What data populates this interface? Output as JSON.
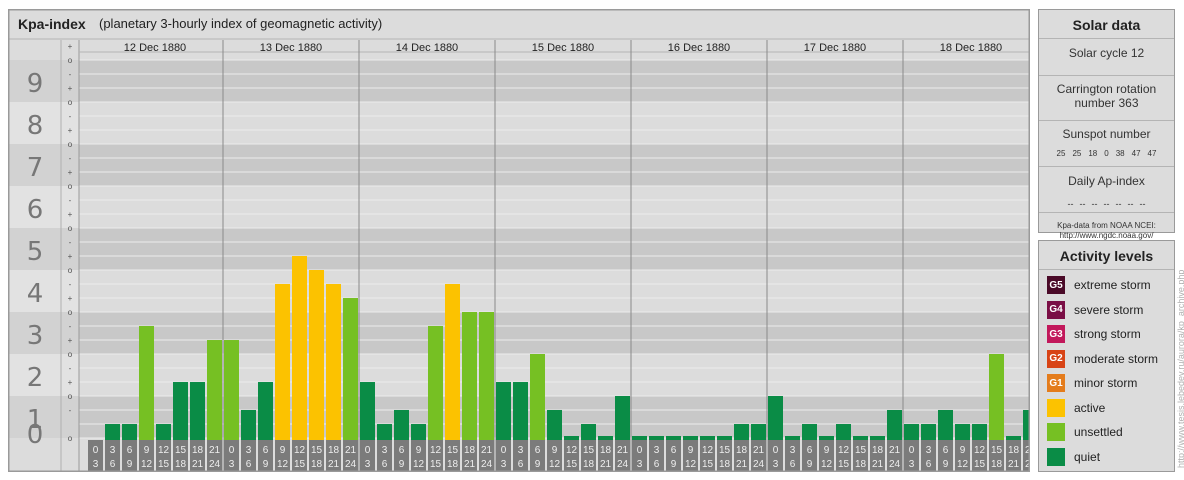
{
  "chart": {
    "title": "Kpa-index",
    "subtitle": "(planetary 3-hourly index of geomagnetic activity)"
  },
  "chart_data": {
    "type": "bar",
    "ylim": [
      0,
      9
    ],
    "y_ticks": [
      "0",
      "1",
      "2",
      "3",
      "4",
      "5",
      "6",
      "7",
      "8",
      "9"
    ],
    "sub_ticks": [
      "-",
      "o",
      "+"
    ],
    "days": [
      "12 Dec 1880",
      "13 Dec 1880",
      "14 Dec 1880",
      "15 Dec 1880",
      "16 Dec 1880",
      "17 Dec 1880",
      "18 Dec 1880"
    ],
    "interval_starts": [
      "0",
      "3",
      "6",
      "9",
      "12",
      "15",
      "18",
      "21"
    ],
    "interval_ends": [
      "3",
      "6",
      "9",
      "12",
      "15",
      "18",
      "21",
      "24"
    ],
    "values": [
      [
        0.333,
        0.333,
        2.667,
        0.333,
        1.333,
        1.333,
        2.333
      ],
      [
        2.333,
        0.667,
        1.333,
        3.667,
        4.333,
        4.0,
        3.667,
        3.333
      ],
      [
        1.333,
        0.333,
        0.667,
        0.333,
        2.667,
        3.667,
        3.0,
        3.0
      ],
      [
        1.333,
        1.333,
        2.0,
        0.667,
        0.0,
        0.333,
        0.0,
        1.0
      ],
      [
        0.0,
        0.0,
        0.0,
        0.0,
        0.0,
        0.0,
        0.333,
        0.333
      ],
      [
        1.0,
        0.0,
        0.333,
        0.0,
        0.333,
        0.0,
        0.0,
        0.667
      ],
      [
        0.333,
        0.333,
        0.667,
        0.333,
        0.333,
        2.0,
        0.0,
        0.667
      ]
    ],
    "colors": {
      "quiet": "#0a8c46",
      "unsettled": "#76c023",
      "active": "#fcc200",
      "axis_number": "#777777",
      "interval_cell": "#7b7b7b",
      "band_dark": "#c8c8c8",
      "band_light": "#dcdcdc"
    },
    "grid": true
  },
  "solar": {
    "title": "Solar data",
    "cycle": "Solar cycle 12",
    "carrington_line1": "Carrington rotation",
    "carrington_line2": "number 363",
    "sunspot_title": "Sunspot number",
    "sunspots": [
      "25",
      "25",
      "18",
      "0",
      "38",
      "47",
      "47"
    ],
    "ap_title": "Daily Ap-index",
    "ap_values": [
      "--",
      "--",
      "--",
      "--",
      "--",
      "--",
      "--"
    ],
    "source_line1": "Kpa-data from NOAA NCEI:",
    "source_line2": "http://www.ngdc.noaa.gov/"
  },
  "activity": {
    "title": "Activity levels",
    "items": [
      {
        "badge": "G5",
        "label": "extreme storm",
        "color": "#4a0a28"
      },
      {
        "badge": "G4",
        "label": "severe storm",
        "color": "#7a0e45"
      },
      {
        "badge": "G3",
        "label": "strong storm",
        "color": "#c2185b"
      },
      {
        "badge": "G2",
        "label": "moderate storm",
        "color": "#d84315"
      },
      {
        "badge": "G1",
        "label": "minor storm",
        "color": "#e47c1c"
      },
      {
        "badge": "",
        "label": "active",
        "color": "#fcc200"
      },
      {
        "badge": "",
        "label": "unsettled",
        "color": "#76c023"
      },
      {
        "badge": "",
        "label": "quiet",
        "color": "#0a8c46"
      }
    ]
  },
  "watermark": "http://www.tesis.lebedev.ru/aurora/kp_archive.php"
}
